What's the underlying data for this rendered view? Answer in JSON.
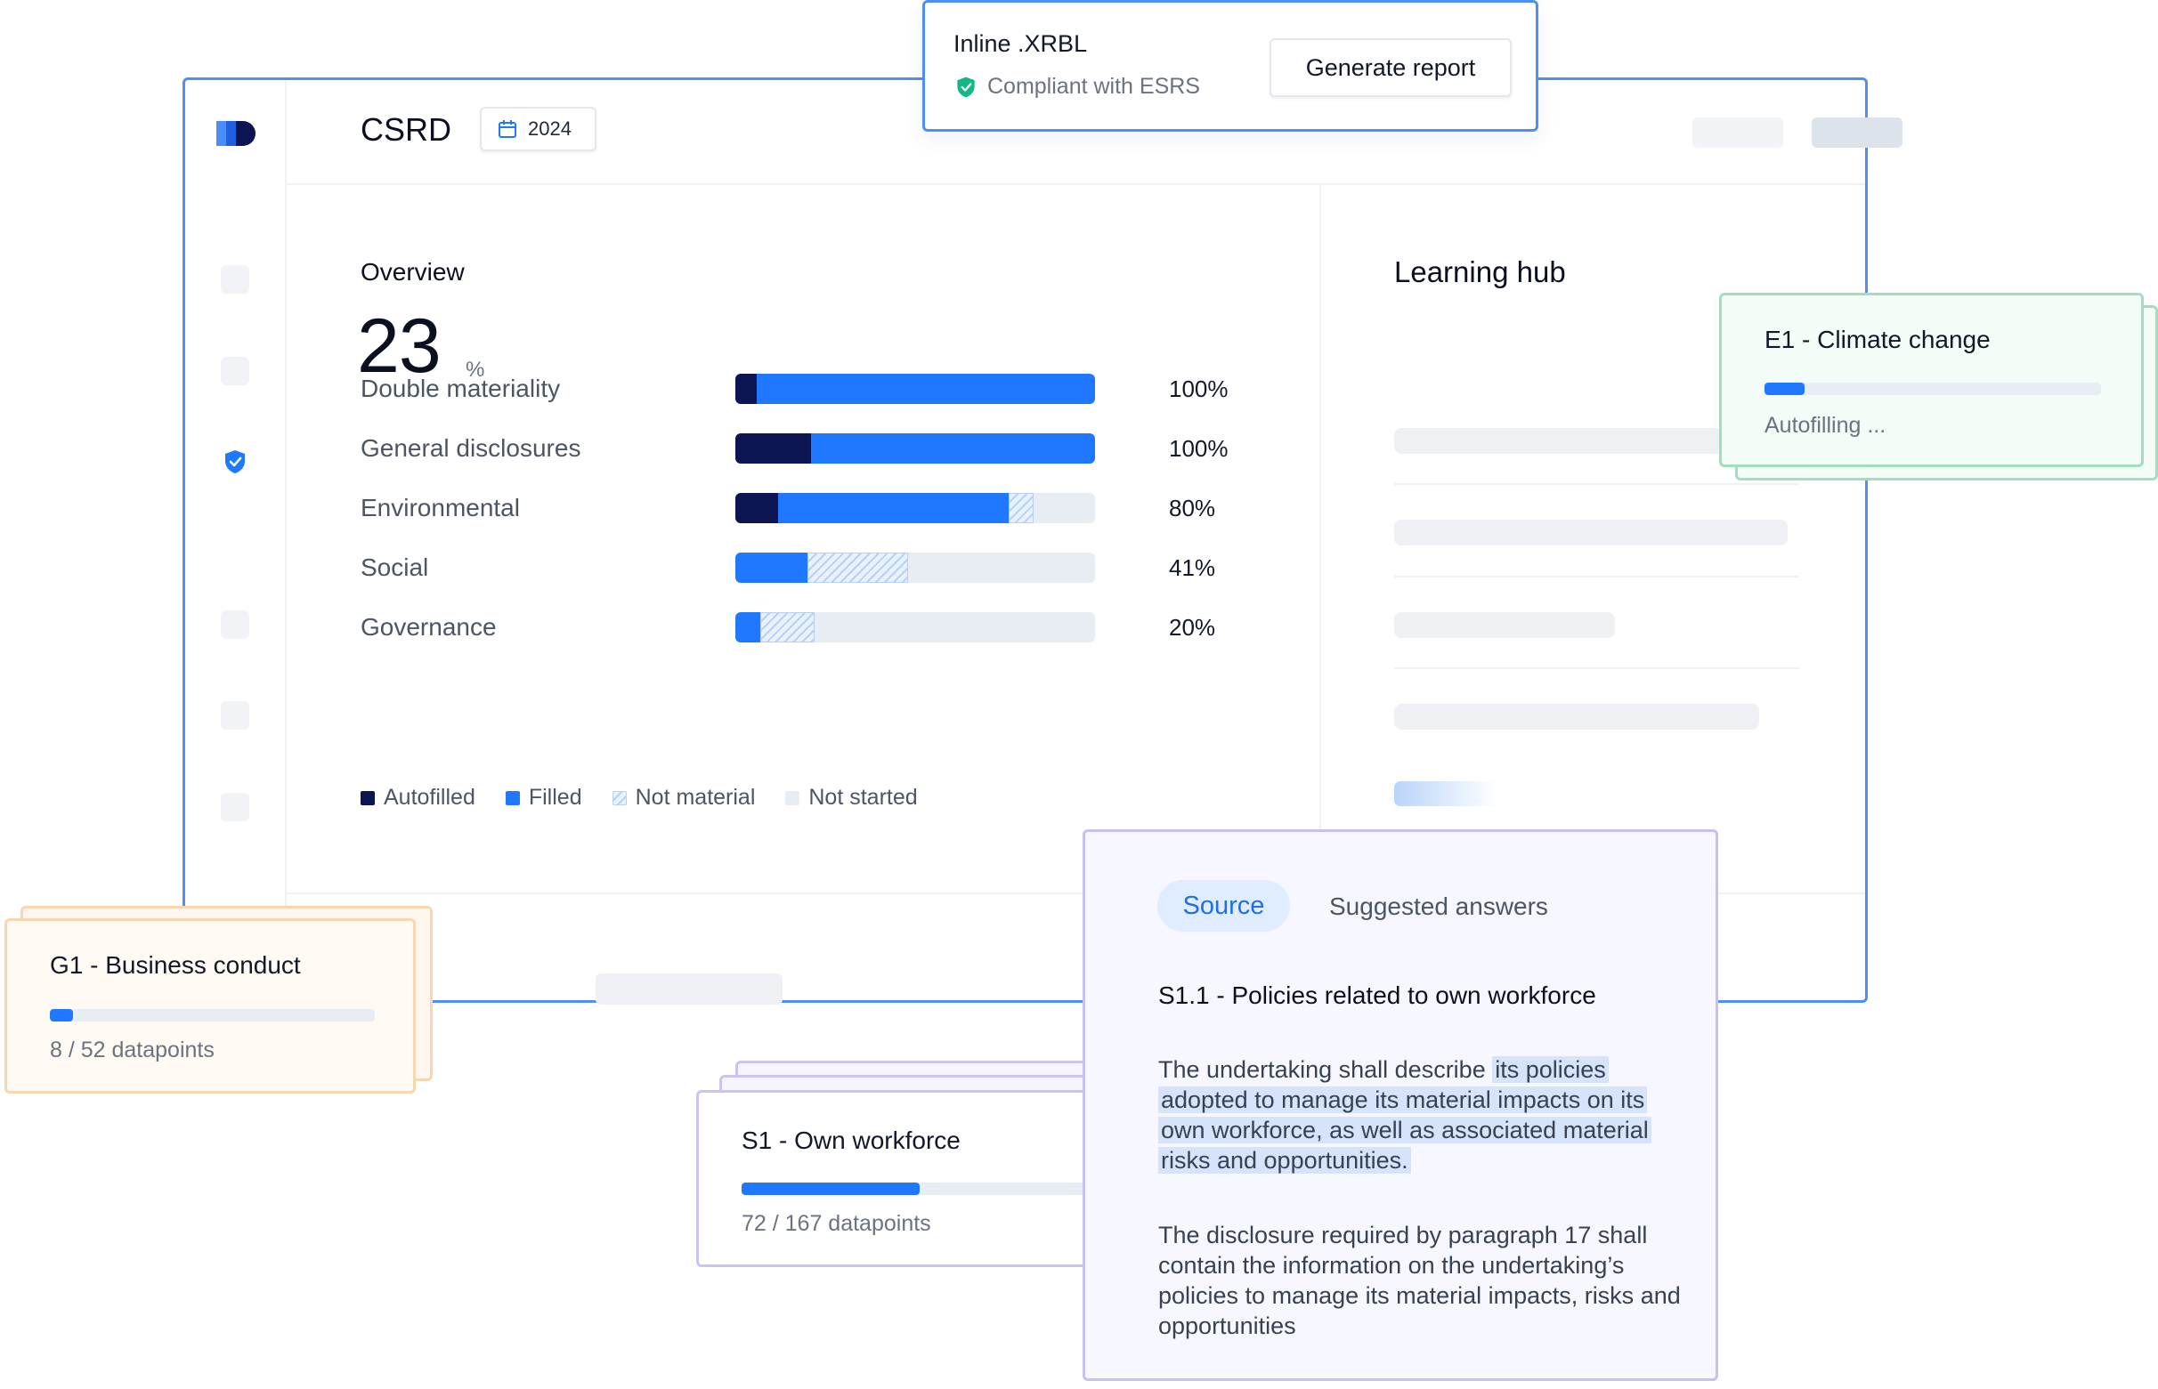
{
  "app": {
    "title": "CSRD",
    "year": "2024"
  },
  "overview": {
    "label": "Overview",
    "percent": "23",
    "unit": "%",
    "rows": [
      {
        "label": "Double materiality",
        "value": "100%",
        "autofilled": 0.06,
        "filled": 0.94,
        "not_material": 0.0
      },
      {
        "label": "General disclosures",
        "value": "100%",
        "autofilled": 0.21,
        "filled": 0.79,
        "not_material": 0.0
      },
      {
        "label": "Environmental",
        "value": "80%",
        "autofilled": 0.12,
        "filled": 0.64,
        "not_material": 0.07
      },
      {
        "label": "Social",
        "value": "41%",
        "autofilled": 0.0,
        "filled": 0.2,
        "not_material": 0.28
      },
      {
        "label": "Governance",
        "value": "20%",
        "autofilled": 0.0,
        "filled": 0.07,
        "not_material": 0.15
      }
    ],
    "legend": [
      {
        "label": "Autofilled",
        "color": "#0c1552"
      },
      {
        "label": "Filled",
        "color": "#1f78ff"
      },
      {
        "label": "Not material",
        "color": "hatched"
      },
      {
        "label": "Not started",
        "color": "#e8ecf3"
      }
    ]
  },
  "learning_hub": {
    "title": "Learning hub"
  },
  "xbrl": {
    "title": "Inline .XRBL",
    "compliance": "Compliant with ESRS",
    "button": "Generate report"
  },
  "cards": {
    "e1": {
      "title": "E1 - Climate change",
      "status": "Autofilling ...",
      "progress": 0.12
    },
    "g1": {
      "title": "G1 - Business conduct",
      "datapoints": "8 / 52 datapoints",
      "progress": 0.07
    },
    "s1": {
      "title": "S1 - Own workforce",
      "datapoints": "72 / 167 datapoints",
      "progress": 0.43
    }
  },
  "source_panel": {
    "tabs": [
      "Source",
      "Suggested answers"
    ],
    "heading": "S1.1 - Policies related to own workforce",
    "para1_plain": "The undertaking shall describe ",
    "para1_highlight": "its policies adopted to manage its material impacts on its own workforce, as well as associated material risks and opportunities.",
    "para2": "The disclosure required by paragraph 17 shall contain the information on the undertaking’s policies to manage its material impacts, risks and opportunities"
  },
  "colors": {
    "accent": "#1f78ff",
    "navy": "#0c1552",
    "window_border": "#4f8ef7",
    "success": "#12b886"
  }
}
